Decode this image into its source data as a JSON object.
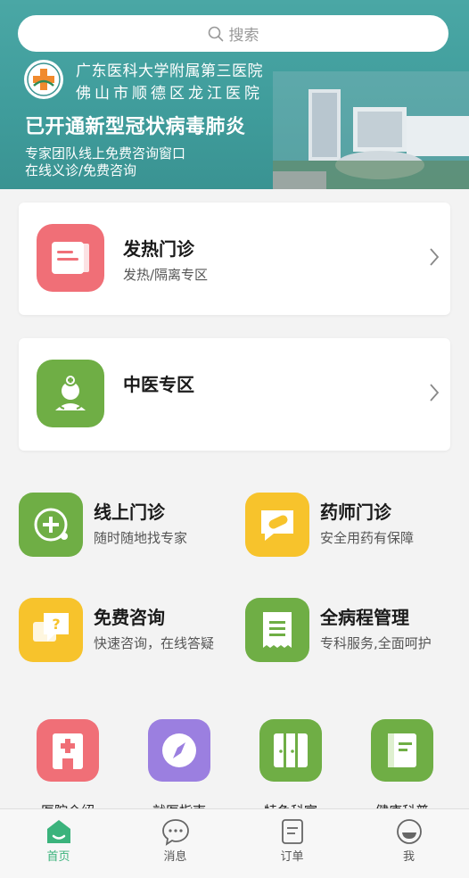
{
  "search": {
    "placeholder": "搜索"
  },
  "banner": {
    "hospital_line1": "广东医科大学附属第三医院",
    "hospital_line2": "佛山市顺德区龙江医院",
    "headline": "已开通新型冠状病毒肺炎",
    "sub_line1": "专家团队线上免费咨询窗口",
    "sub_line2": "在线义诊/免费咨询"
  },
  "cards": [
    {
      "title": "发热门诊",
      "desc": "发热/隔离专区",
      "icon": "fever-clinic-icon"
    },
    {
      "title": "中医专区",
      "desc": "",
      "icon": "tcm-doctor-icon"
    }
  ],
  "services": [
    {
      "title": "线上门诊",
      "desc": "随时随地找专家",
      "icon": "online-clinic-icon"
    },
    {
      "title": "药师门诊",
      "desc": "安全用药有保障",
      "icon": "pharmacist-icon"
    },
    {
      "title": "免费咨询",
      "desc": "快速咨询，在线答疑",
      "icon": "consult-chat-icon"
    },
    {
      "title": "全病程管理",
      "desc": "专科服务,全面呵护",
      "icon": "disease-management-icon"
    }
  ],
  "bottom_row": [
    {
      "label": "医院介绍",
      "icon": "hospital-icon",
      "color": "#f06f77"
    },
    {
      "label": "就医指南",
      "icon": "compass-icon",
      "color": "#9b7fe0"
    },
    {
      "label": "特色科室",
      "icon": "departments-icon",
      "color": "#6fae45"
    },
    {
      "label": "健康科普",
      "icon": "health-book-icon",
      "color": "#6fae45"
    }
  ],
  "tabs": [
    {
      "label": "首页",
      "icon": "home-icon",
      "active": true
    },
    {
      "label": "消息",
      "icon": "message-icon",
      "active": false
    },
    {
      "label": "订单",
      "icon": "order-icon",
      "active": false
    },
    {
      "label": "我",
      "icon": "profile-icon",
      "active": false
    }
  ],
  "colors": {
    "banner": "#42a09f",
    "accent_green": "#3bb37c",
    "red": "#f06f77",
    "green": "#6fae45",
    "yellow": "#f7c32c",
    "purple": "#9b7fe0"
  }
}
